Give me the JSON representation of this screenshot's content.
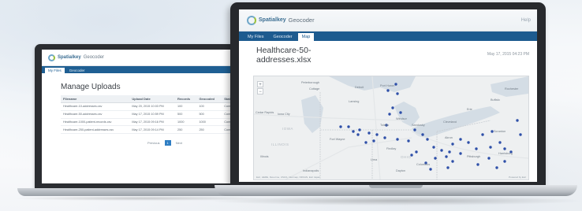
{
  "brand": {
    "logo_text": "Spatialkey",
    "app_name": "Geocoder"
  },
  "uploads_screen": {
    "tabs": [
      "My Files",
      "Geocoder"
    ],
    "title": "Manage Uploads",
    "columns": [
      "Filename",
      "Upload Date",
      "Records",
      "Geocoded",
      "Status"
    ],
    "rows": [
      [
        "Healthcare-10-addresses.csv",
        "May 20, 2015 10:03 PM",
        "100",
        "100",
        "Complete"
      ],
      [
        "Healthcare-50-addresses.csv",
        "May 17, 2015 10:59 PM",
        "500",
        "500",
        "Complete"
      ],
      [
        "Healthcare-1000-patient-records.csv",
        "May 17, 2015 09:16 PM",
        "1000",
        "1000",
        "Complete"
      ],
      [
        "Healthcare-250-patient-addresses.csv",
        "May 17, 2015 09:14 PM",
        "250",
        "250",
        "Complete"
      ]
    ],
    "pager": {
      "prev": "Previous",
      "current": "1",
      "next": "Next"
    }
  },
  "map_screen": {
    "help": "Help",
    "tabs": [
      "My Files",
      "Geocoder",
      "Map"
    ],
    "active_tab": "Map",
    "file_title": "Healthcare-50-addresses.xlsx",
    "date": "May 17, 2015 04:23 PM",
    "zoom_in": "+",
    "zoom_out": "−",
    "place_labels": [
      {
        "text": "Peterborough",
        "cls": "city"
      },
      {
        "text": "Cottage",
        "cls": "city"
      },
      {
        "text": "Detroit",
        "cls": "city"
      },
      {
        "text": "Port Huron",
        "cls": "city"
      },
      {
        "text": "Lansing",
        "cls": "city"
      },
      {
        "text": "Windsor",
        "cls": "city"
      },
      {
        "text": "Toledo",
        "cls": "city"
      },
      {
        "text": "Sandusky",
        "cls": "city"
      },
      {
        "text": "Cleveland",
        "cls": "city"
      },
      {
        "text": "Erie",
        "cls": "city"
      },
      {
        "text": "Buffalo",
        "cls": "city"
      },
      {
        "text": "Rochester",
        "cls": "city"
      },
      {
        "text": "Cedar Rapids",
        "cls": "city"
      },
      {
        "text": "Iowa City",
        "cls": "city"
      },
      {
        "text": "Fort Wayne",
        "cls": "city"
      },
      {
        "text": "Findlay",
        "cls": "city"
      },
      {
        "text": "Akron",
        "cls": "city"
      },
      {
        "text": "Columbus",
        "cls": "city"
      },
      {
        "text": "Pittsburgh",
        "cls": "city"
      },
      {
        "text": "Harrisburg",
        "cls": "city"
      },
      {
        "text": "Scranton",
        "cls": "city"
      },
      {
        "text": "Lima",
        "cls": "city"
      },
      {
        "text": "Dayton",
        "cls": "city"
      },
      {
        "text": "Indianapolis",
        "cls": "city"
      },
      {
        "text": "Illinois",
        "cls": "city"
      },
      {
        "text": "IOWA",
        "cls": "region"
      },
      {
        "text": "OHIO",
        "cls": "region"
      },
      {
        "text": "ILLINOIS",
        "cls": "region"
      }
    ],
    "attribution": "Esri, HERE, DeLorme, USGS, Intermap, NRCAN, Esri Japan",
    "powered_by": "Powered by Esri",
    "accent_color": "#1d5b8f",
    "marker_color": "#2e4fa8"
  }
}
